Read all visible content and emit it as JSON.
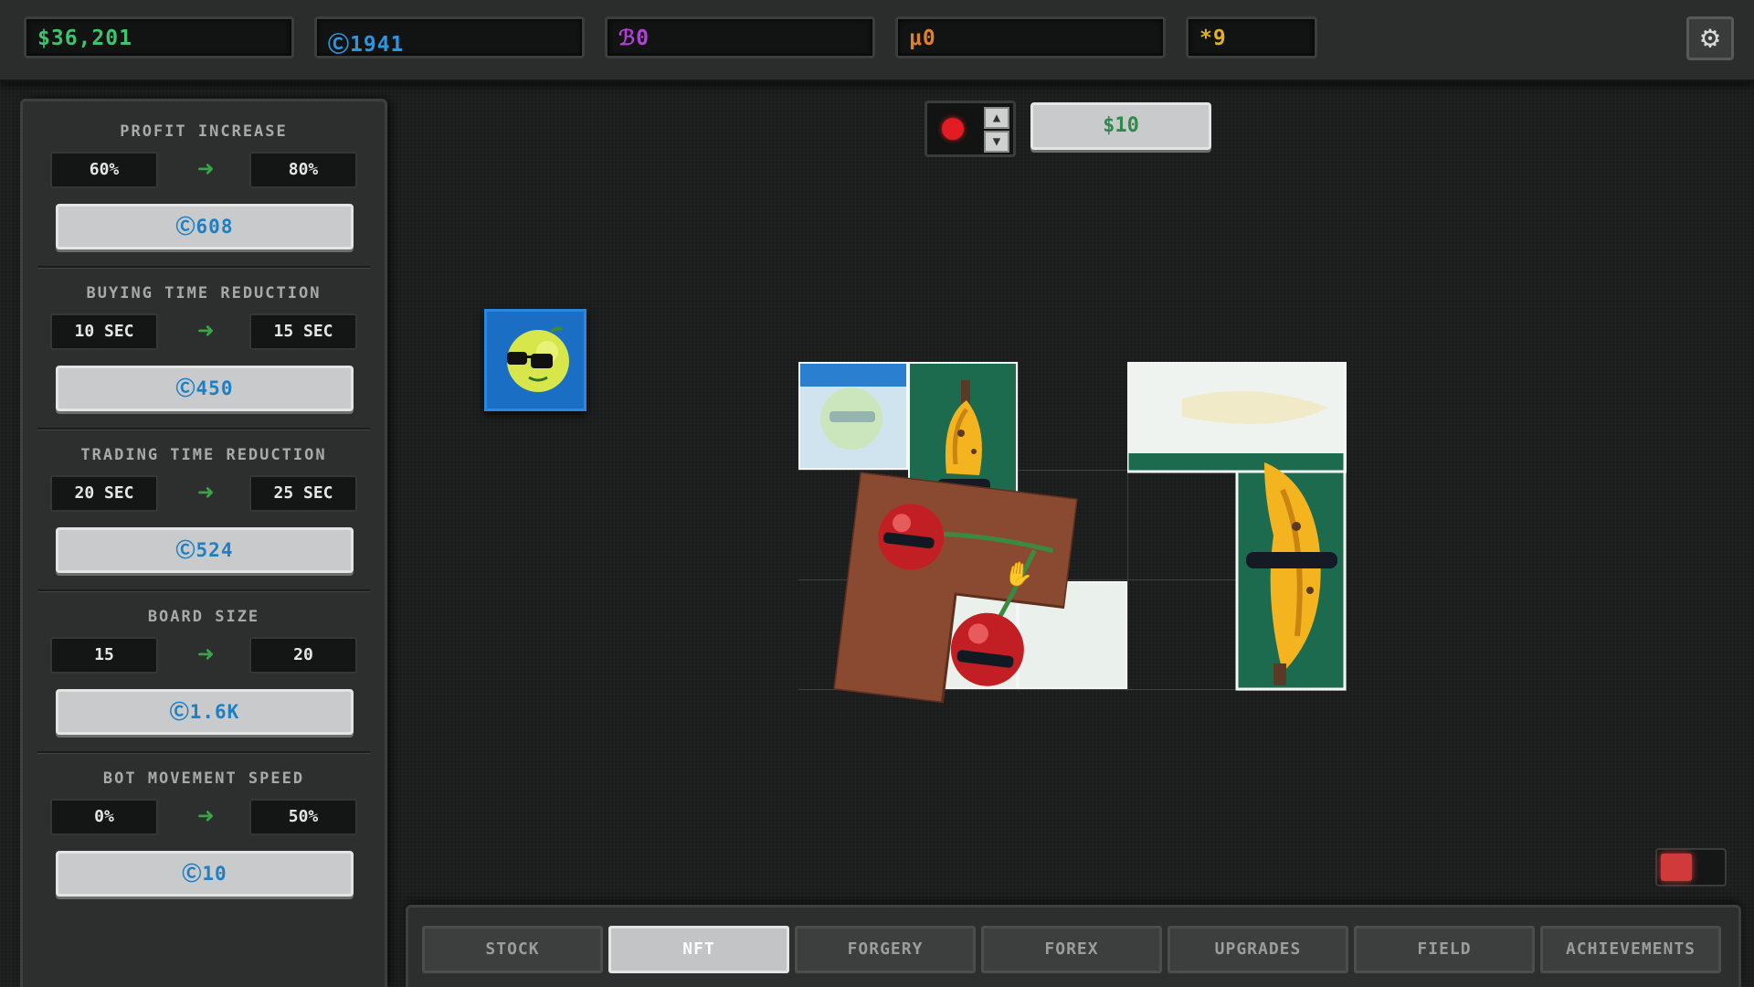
{
  "resources": [
    {
      "name": "money",
      "value": "$36,201",
      "color": "#3ec46d"
    },
    {
      "name": "credits",
      "value": "Ⓒ1941",
      "color": "#2c97e0"
    },
    {
      "name": "influence",
      "value": "ℬ0",
      "color": "#b440d6"
    },
    {
      "name": "micro",
      "value": "μ0",
      "color": "#e0802b"
    },
    {
      "name": "stars",
      "value": "*9",
      "color": "#e0b12b"
    }
  ],
  "settings": {
    "icon": "gear-icon"
  },
  "upgrades": [
    {
      "title": "PROFIT INCREASE",
      "from": "60%",
      "to": "80%",
      "cost": "Ⓒ608"
    },
    {
      "title": "BUYING TIME REDUCTION",
      "from": "10 SEC",
      "to": "15 SEC",
      "cost": "Ⓒ450"
    },
    {
      "title": "TRADING TIME REDUCTION",
      "from": "20 SEC",
      "to": "25 SEC",
      "cost": "Ⓒ524"
    },
    {
      "title": "BOARD SIZE",
      "from": "15",
      "to": "20",
      "cost": "Ⓒ1.6K"
    },
    {
      "title": "BOT MOVEMENT SPEED",
      "from": "0%",
      "to": "50%",
      "cost": "Ⓒ10"
    }
  ],
  "board": {
    "selected_color": "#e21c22",
    "price_label": "$10"
  },
  "tabs": [
    {
      "label": "STOCK",
      "active": false
    },
    {
      "label": "NFT",
      "active": true
    },
    {
      "label": "FORGERY",
      "active": false
    },
    {
      "label": "FOREX",
      "active": false
    },
    {
      "label": "UPGRADES",
      "active": false
    },
    {
      "label": "FIELD",
      "active": false
    },
    {
      "label": "ACHIEVEMENTS",
      "active": false
    }
  ],
  "colors": {
    "accent_green": "#3ca34a",
    "cost_blue": "#1f7fc2",
    "tile_green": "#1d6b4f",
    "cherry_brown": "#8a4a32"
  }
}
